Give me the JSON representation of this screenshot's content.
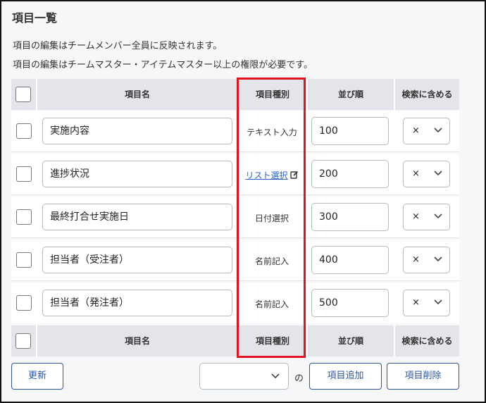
{
  "title": "項目一覧",
  "notes": [
    "項目の編集はチームメンバー全員に反映されます。",
    "項目の編集はチームマスター・アイテムマスター以上の権限が必要です。"
  ],
  "columns": {
    "name": "項目名",
    "type": "項目種別",
    "order": "並び順",
    "searchable": "検索に含める"
  },
  "rows": [
    {
      "name": "実施内容",
      "type": "テキスト入力",
      "type_is_link": false,
      "order": "100",
      "searchable": "×"
    },
    {
      "name": "進捗状況",
      "type": "リスト選択",
      "type_is_link": true,
      "order": "200",
      "searchable": "×"
    },
    {
      "name": "最終打合せ実施日",
      "type": "日付選択",
      "type_is_link": false,
      "order": "300",
      "searchable": "×"
    },
    {
      "name": "担当者（受注者）",
      "type": "名前記入",
      "type_is_link": false,
      "order": "400",
      "searchable": "×"
    },
    {
      "name": "担当者（発注者）",
      "type": "名前記入",
      "type_is_link": false,
      "order": "500",
      "searchable": "×"
    }
  ],
  "footer": {
    "update_label": "更新",
    "count_value": "",
    "of_label": "の",
    "add_label": "項目追加",
    "delete_label": "項目削除"
  },
  "colors": {
    "highlight": "#e0141e",
    "link": "#2563c9",
    "button": "#2f56a0",
    "header_bg": "#e3e5ea"
  },
  "icons": {
    "edit": "edit-icon",
    "select_chevron": "chevron-down-icon"
  }
}
